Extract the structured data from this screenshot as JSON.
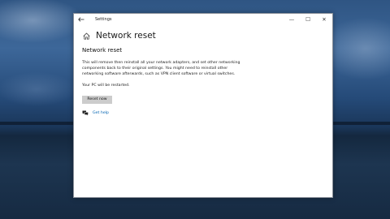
{
  "window": {
    "app_title": "Settings",
    "controls": {
      "minimize": "—",
      "maximize": "☐",
      "close": "✕"
    }
  },
  "header": {
    "title": "Network reset",
    "icon": "home-icon"
  },
  "main": {
    "section_title": "Network reset",
    "description": "This will remove then reinstall all your network adapters, and set other networking components back to their original settings. You might need to reinstall other networking software afterwards, such as VPN client software or virtual switches.",
    "restart_note": "Your PC will be restarted.",
    "reset_button_label": "Reset now",
    "help_link_label": "Get help"
  },
  "colors": {
    "accent": "#0063b1",
    "button_bg": "#cccccc"
  }
}
